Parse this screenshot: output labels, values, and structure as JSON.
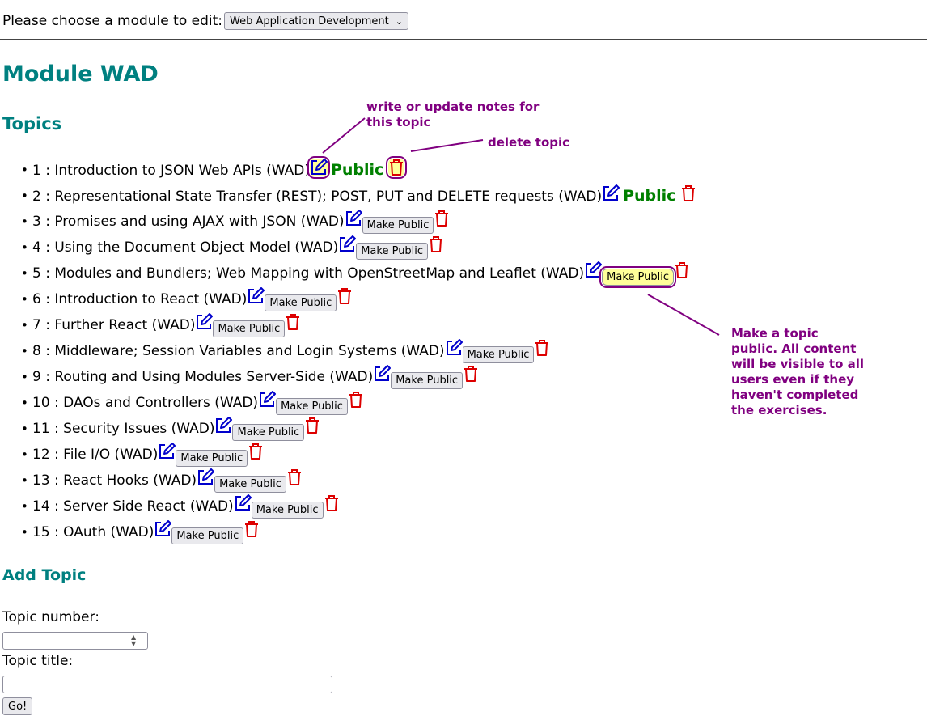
{
  "module_select": {
    "label": "Please choose a module to edit:",
    "selected": "Web Application Development"
  },
  "page_title": "Module WAD",
  "topics_heading": "Topics",
  "topics": [
    {
      "text": "1 : Introduction to JSON Web APIs (WAD)",
      "public": true
    },
    {
      "text": "2 : Representational State Transfer (REST); POST, PUT and DELETE requests (WAD)",
      "public": true
    },
    {
      "text": "3 : Promises and using AJAX with JSON (WAD)",
      "public": false
    },
    {
      "text": "4 : Using the Document Object Model (WAD)",
      "public": false
    },
    {
      "text": "5 : Modules and Bundlers; Web Mapping with OpenStreetMap and Leaflet (WAD)",
      "public": false
    },
    {
      "text": "6 : Introduction to React (WAD)",
      "public": false
    },
    {
      "text": "7 : Further React (WAD)",
      "public": false
    },
    {
      "text": "8 : Middleware; Session Variables and Login Systems (WAD)",
      "public": false
    },
    {
      "text": "9 : Routing and Using Modules Server-Side (WAD)",
      "public": false
    },
    {
      "text": "10 : DAOs and Controllers (WAD)",
      "public": false
    },
    {
      "text": "11 : Security Issues (WAD)",
      "public": false
    },
    {
      "text": "12 : File I/O (WAD)",
      "public": false
    },
    {
      "text": "13 : React Hooks (WAD)",
      "public": false
    },
    {
      "text": "14 : Server Side React (WAD)",
      "public": false
    },
    {
      "text": "15 : OAuth (WAD)",
      "public": false
    }
  ],
  "public_label": "Public",
  "make_public_label": "Make Public",
  "add_topic": {
    "heading": "Add Topic",
    "number_label": "Topic number:",
    "number_value": "",
    "title_label": "Topic title:",
    "title_value": "",
    "go_label": "Go!"
  },
  "annotations": {
    "notes_line1": "write or update notes for",
    "notes_line2": "this topic",
    "delete": "delete topic",
    "public_lines": [
      "Make a topic",
      "public. All content",
      "will be visible to all",
      "users even if they",
      "haven't completed",
      "the exercises."
    ]
  },
  "colors": {
    "heading": "#008080",
    "public": "#008000",
    "edit_icon": "#0000cc",
    "trash_icon": "#dd0000",
    "annotation": "#800080",
    "highlight": "#ffff99"
  },
  "icons": {
    "edit": "edit-pencil-icon",
    "delete": "trash-icon"
  }
}
